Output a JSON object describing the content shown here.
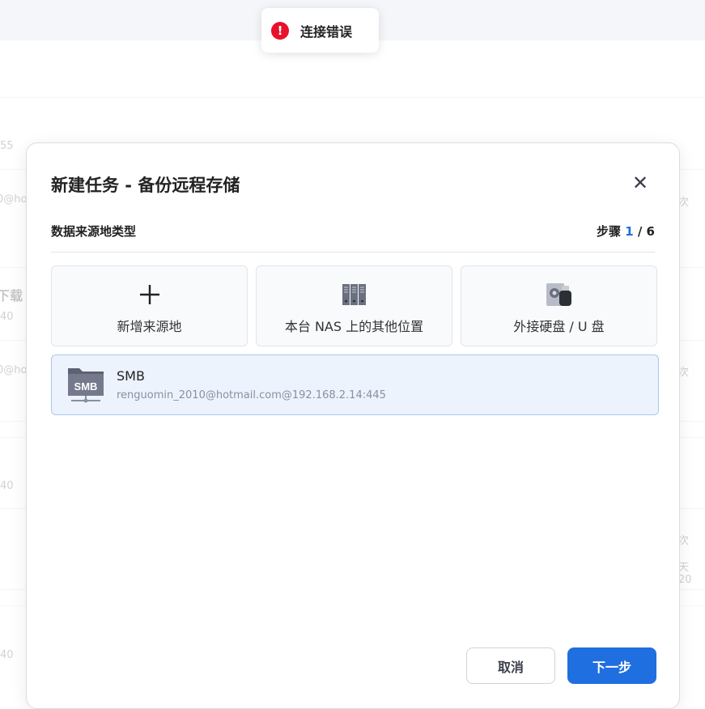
{
  "background": {
    "left_fragments": [
      "55",
      "0@ho",
      "下载",
      "40",
      "0@ho",
      "40",
      "40"
    ],
    "right_fragments": [
      "次",
      "次",
      "次",
      "天 20"
    ]
  },
  "toast": {
    "icon": "error-icon",
    "text": "连接错误",
    "color": "#e8102a"
  },
  "dialog": {
    "title": "新建任务 - 备份远程存储",
    "section_title": "数据来源地类型",
    "step_label": "步骤",
    "step_current": "1",
    "step_total": "/ 6",
    "options": [
      {
        "label": "新增来源地",
        "icon": "plus-icon"
      },
      {
        "label": "本台 NAS 上的其他位置",
        "icon": "nas-server-icon"
      },
      {
        "label": "外接硬盘 / U 盘",
        "icon": "usb-drive-icon"
      }
    ],
    "source": {
      "icon_text": "SMB",
      "name": "SMB",
      "address": "renguomin_2010@hotmail.com@192.168.2.14:445"
    },
    "cancel_label": "取消",
    "next_label": "下一步",
    "accent": "#1f6fe0"
  }
}
